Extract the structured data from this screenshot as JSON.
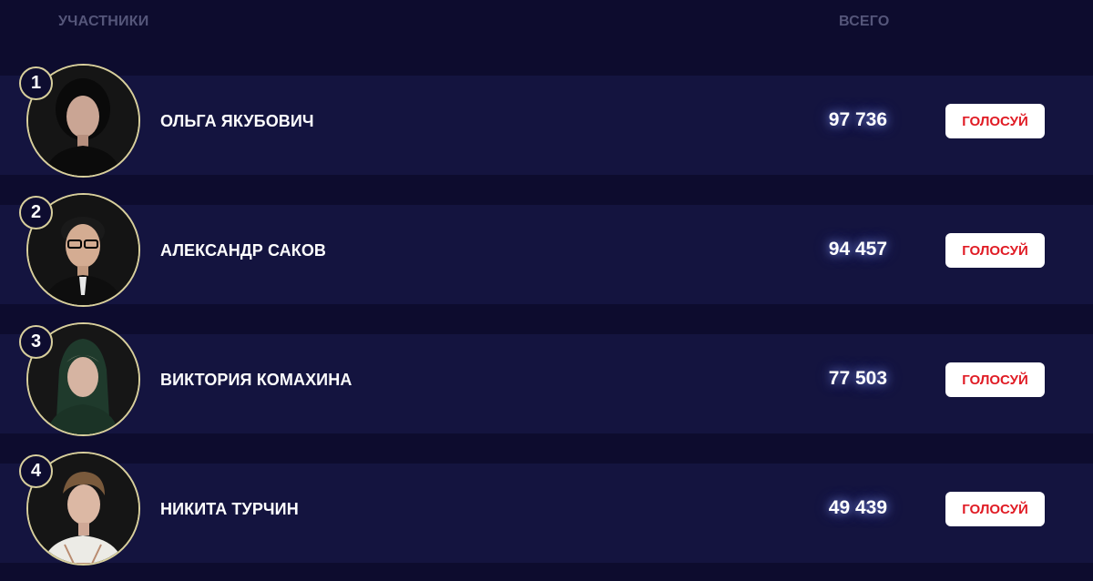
{
  "header": {
    "participants_label": "УЧАСТНИКИ",
    "total_label": "ВСЕГО"
  },
  "participants": [
    {
      "rank": "1",
      "name": "ОЛЬГА ЯКУБОВИЧ",
      "votes": "97 736",
      "button": "ГОЛОСУЙ",
      "avatar_icon": "person-photo-icon"
    },
    {
      "rank": "2",
      "name": "АЛЕКСАНДР САКОВ",
      "votes": "94 457",
      "button": "ГОЛОСУЙ",
      "avatar_icon": "person-photo-icon"
    },
    {
      "rank": "3",
      "name": "ВИКТОРИЯ КОМАХИНА",
      "votes": "77 503",
      "button": "ГОЛОСУЙ",
      "avatar_icon": "person-photo-icon"
    },
    {
      "rank": "4",
      "name": "НИКИТА ТУРЧИН",
      "votes": "49 439",
      "button": "ГОЛОСУЙ",
      "avatar_icon": "person-photo-icon"
    }
  ],
  "colors": {
    "background": "#0d0c2e",
    "row_band": "#14143f",
    "avatar_border": "#d8cf9c",
    "button_text": "#e01b24",
    "header_text": "#55567a"
  }
}
